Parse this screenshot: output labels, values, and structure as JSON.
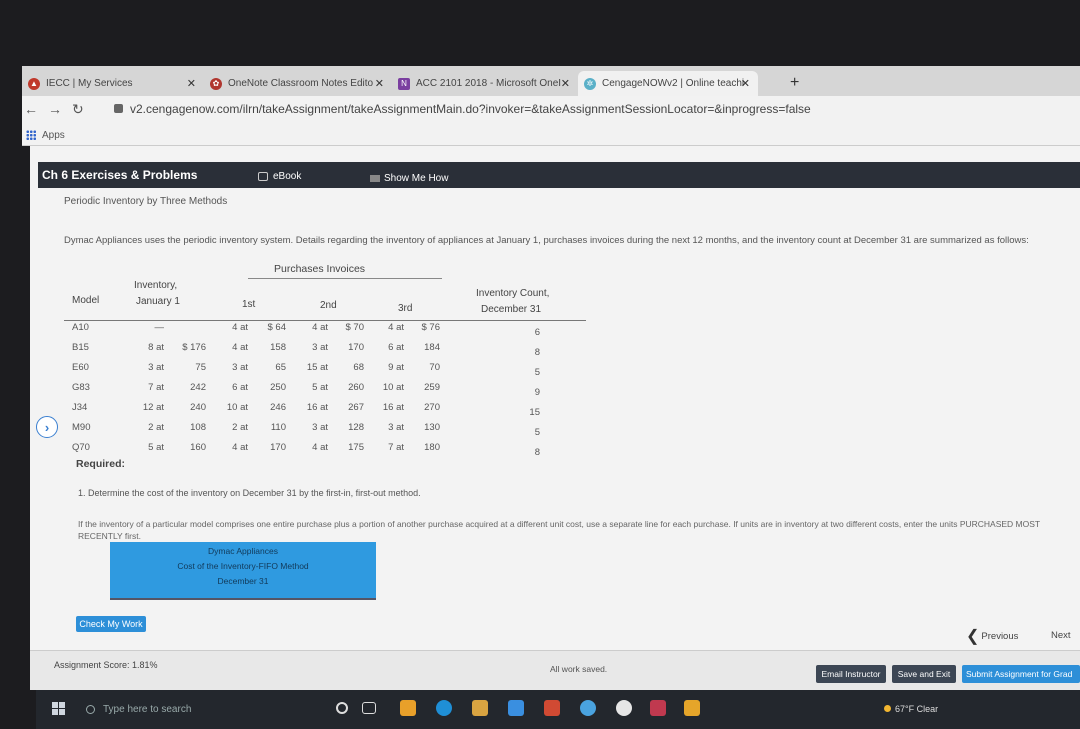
{
  "tabs": [
    {
      "title": "IECC | My Services"
    },
    {
      "title": "OneNote Classroom Notes Edito"
    },
    {
      "title": "ACC 2101 2018 - Microsoft OneI"
    },
    {
      "title": "CengageNOWv2 | Online teachi"
    }
  ],
  "browser": {
    "url": "v2.cengagenow.com/ilrn/takeAssignment/takeAssignmentMain.do?invoker=&takeAssignmentSessionLocator=&inprogress=false",
    "bookmarks_label": "Apps"
  },
  "module": {
    "title": "Ch 6 Exercises & Problems",
    "ebook": "eBook",
    "show_me": "Show Me How"
  },
  "problem": {
    "subtitle": "Periodic Inventory by Three Methods",
    "intro": "Dymac Appliances uses the periodic inventory system. Details regarding the inventory of appliances at January 1, purchases invoices during the next 12 months, and the inventory count at December 31 are summarized as follows:",
    "purchases_title": "Purchases Invoices"
  },
  "table": {
    "headers": {
      "model": "Model",
      "inv_jan_1": "Inventory,",
      "inv_jan_2": "January 1",
      "first": "1st",
      "second": "2nd",
      "third": "3rd",
      "count_1": "Inventory Count,",
      "count_2": "December 31"
    },
    "rows": [
      {
        "model": "A10",
        "jq": "—",
        "ju": "",
        "p1q": "4 at",
        "p1u": "$ 64",
        "p2q": "4 at",
        "p2u": "$ 70",
        "p3q": "4 at",
        "p3u": "$ 76",
        "count": "6"
      },
      {
        "model": "B15",
        "jq": "8 at",
        "ju": "$ 176",
        "p1q": "4 at",
        "p1u": "158",
        "p2q": "3 at",
        "p2u": "170",
        "p3q": "6 at",
        "p3u": "184",
        "count": "8"
      },
      {
        "model": "E60",
        "jq": "3 at",
        "ju": "75",
        "p1q": "3 at",
        "p1u": "65",
        "p2q": "15 at",
        "p2u": "68",
        "p3q": "9 at",
        "p3u": "70",
        "count": "5"
      },
      {
        "model": "G83",
        "jq": "7 at",
        "ju": "242",
        "p1q": "6 at",
        "p1u": "250",
        "p2q": "5 at",
        "p2u": "260",
        "p3q": "10 at",
        "p3u": "259",
        "count": "9"
      },
      {
        "model": "J34",
        "jq": "12 at",
        "ju": "240",
        "p1q": "10 at",
        "p1u": "246",
        "p2q": "16 at",
        "p2u": "267",
        "p3q": "16 at",
        "p3u": "270",
        "count": "15"
      },
      {
        "model": "M90",
        "jq": "2 at",
        "ju": "108",
        "p1q": "2 at",
        "p1u": "110",
        "p2q": "3 at",
        "p2u": "128",
        "p3q": "3 at",
        "p3u": "130",
        "count": "5"
      },
      {
        "model": "Q70",
        "jq": "5 at",
        "ju": "160",
        "p1q": "4 at",
        "p1u": "170",
        "p2q": "4 at",
        "p2u": "175",
        "p3q": "7 at",
        "p3u": "180",
        "count": "8"
      }
    ]
  },
  "required": {
    "label": "Required:",
    "q1": "1.  Determine the cost of the inventory on December 31 by the first-in, first-out method.",
    "instructions": "If the inventory of a particular model comprises one entire purchase plus a portion of another purchase acquired at a different unit cost, use a separate line for each purchase. If units are in inventory at two different costs, enter the units PURCHASED MOST RECENTLY first."
  },
  "answer_box": {
    "line1": "Dymac Appliances",
    "line2": "Cost of the Inventory-FIFO Method",
    "line3": "December 31"
  },
  "buttons": {
    "check": "Check My Work",
    "previous": "Previous",
    "next": "Next",
    "email": "Email Instructor",
    "save_exit": "Save and Exit",
    "submit": "Submit Assignment for Grad"
  },
  "footer": {
    "score": "Assignment Score: 1.81%",
    "saved": "All work saved."
  },
  "taskbar": {
    "search_placeholder": "Type here to search",
    "weather": "67°F  Clear"
  },
  "colors": {
    "header_dark": "#2a2f38",
    "answer_blue": "#2f9ae0",
    "button_blue": "#2d8fd8",
    "footer_btn": "#3c4654"
  }
}
